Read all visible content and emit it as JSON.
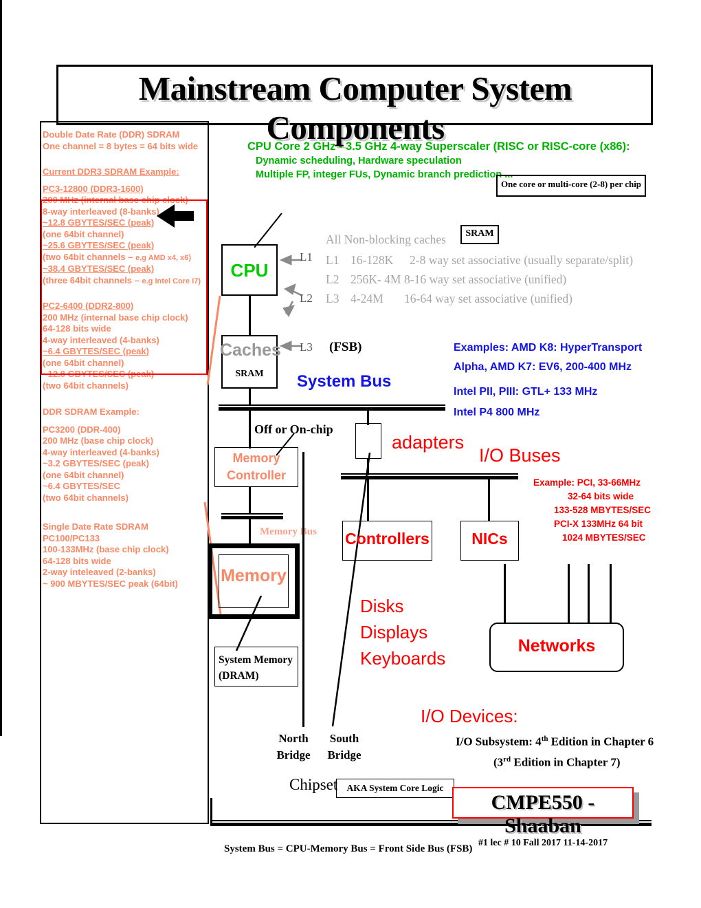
{
  "title": "Mainstream Computer System Components",
  "sidebar": {
    "header": [
      "Double Date Rate  (DDR) SDRAM",
      "One channel = 8 bytes = 64 bits wide"
    ],
    "ddr3_heading": "Current DDR3 SDRAM Example:",
    "ddr3_block": [
      "PC3-12800 (DDR3-1600)",
      "200 MHz (internal base chip clock)",
      "8-way interleaved (8-banks)",
      "~12.8 GBYTES/SEC (peak)",
      "(one 64bit channel)",
      "~25.6  GBYTES/SEC (peak)",
      "(two 64bit channels – ",
      "e,g AMD x4, x6)",
      "~38.4  GBYTES/SEC (peak)",
      "(three 64bit channels – ",
      "e.g Intel Core i7)"
    ],
    "ddr2_block": [
      "PC2-6400 (DDR2-800)",
      "200 MHz (internal base chip clock)",
      "64-128 bits wide",
      "4-way interleaved (4-banks)",
      "~6.4  GBYTES/SEC (peak)",
      "(one 64bit channel)",
      "~12.8  GBYTES/SEC (peak)",
      "(two 64bit channels)"
    ],
    "ddr_heading": "DDR SDRAM Example:",
    "ddr_block": [
      "PC3200 (DDR-400)",
      "200 MHz (base chip clock)",
      "4-way interleaved (4-banks)",
      "~3.2  GBYTES/SEC (peak)",
      "(one 64bit channel)",
      "~6.4  GBYTES/SEC",
      "(two 64bit channels)"
    ],
    "sdr_block": [
      "Single Date Rate SDRAM",
      "PC100/PC133",
      "100-133MHz (base chip clock)",
      "64-128 bits wide",
      "2-way inteleaved (2-banks)",
      "~ 900 MBYTES/SEC peak  (64bit)"
    ]
  },
  "cpu_header": {
    "line1": "CPU Core 2 GHz - 3.5 GHz 4-way Superscaler (RISC or RISC-core (x86):",
    "line2": "Dynamic scheduling, Hardware speculation",
    "line3": "Multiple FP, integer FUs, Dynamic branch prediction ...",
    "one_core_note": "One core or multi-core (2-8) per chip"
  },
  "cpu": {
    "cpu_label": "CPU",
    "caches_label": "Caches",
    "caches_sram": "SRAM",
    "l1": "L1",
    "l2": "L2",
    "l3": "L3"
  },
  "caches_info": {
    "heading": "All   Non-blocking caches",
    "sram_box": "SRAM",
    "rows": [
      {
        "level": "L1",
        "size": "16-128K",
        "assoc": "2-8 way set associative (usually separate/split)"
      },
      {
        "level": "L2",
        "size": "256K- 4M",
        "assoc": "8-16 way set associative  (unified)"
      },
      {
        "level": "L3",
        "size": "4-24M",
        "assoc": "16-64  way set associative  (unified)"
      }
    ]
  },
  "system_bus": {
    "fsb": "(FSB)",
    "label": "System Bus",
    "examples_heading": "Examples:  AMD K8: HyperTransport",
    "examples": [
      "Alpha, AMD K7:  EV6,  200-400 MHz",
      "Intel  PII, PIII:  GTL+    133 MHz",
      "Intel P4                    800 MHz"
    ]
  },
  "memory": {
    "off_on_chip": "Off or On-chip",
    "controller_line1": "Memory",
    "controller_line2": "Controller",
    "memory_bus": "Memory Bus",
    "memory_label": "Memory",
    "system_memory_line1": "System Memory",
    "system_memory_line2": "(DRAM)"
  },
  "io": {
    "adapters": "adapters",
    "io_buses": "I/O Buses",
    "pci_notes": [
      "Example:  PCI,  33-66MHz",
      "32-64 bits wide",
      "133-528 MBYTES/SEC",
      "PCI-X 133MHz 64 bit",
      "1024 MBYTES/SEC"
    ],
    "controllers": "Controllers",
    "nics": "NICs",
    "devices": [
      "Disks",
      "Displays",
      "Keyboards"
    ],
    "networks": "Networks",
    "io_devices_label": "I/O Devices:",
    "io_subsystem_line1": "I/O Subsystem: 4",
    "io_subsystem_sup1": "th",
    "io_subsystem_line1b": " Edition in Chapter 6",
    "io_subsystem_line2": "(3",
    "io_subsystem_sup2": "rd",
    "io_subsystem_line2b": " Edition in Chapter 7)"
  },
  "chipset": {
    "north": "North",
    "north2": "Bridge",
    "south": "South",
    "south2": "Bridge",
    "chipset_label": "Chipset",
    "aka": "AKA System Core Logic"
  },
  "footer": {
    "fsb_note": "System Bus = CPU-Memory Bus = Front Side Bus (FSB)",
    "course": "CMPE550 - Shaaban",
    "meta": "#1   lec # 10   Fall  2017   11-14-2017"
  },
  "colors": {
    "salmon": "#F98866",
    "red": "#FF0000",
    "green": "#00CC00",
    "blue": "#1414E6",
    "grey": "#A6A6A6"
  }
}
